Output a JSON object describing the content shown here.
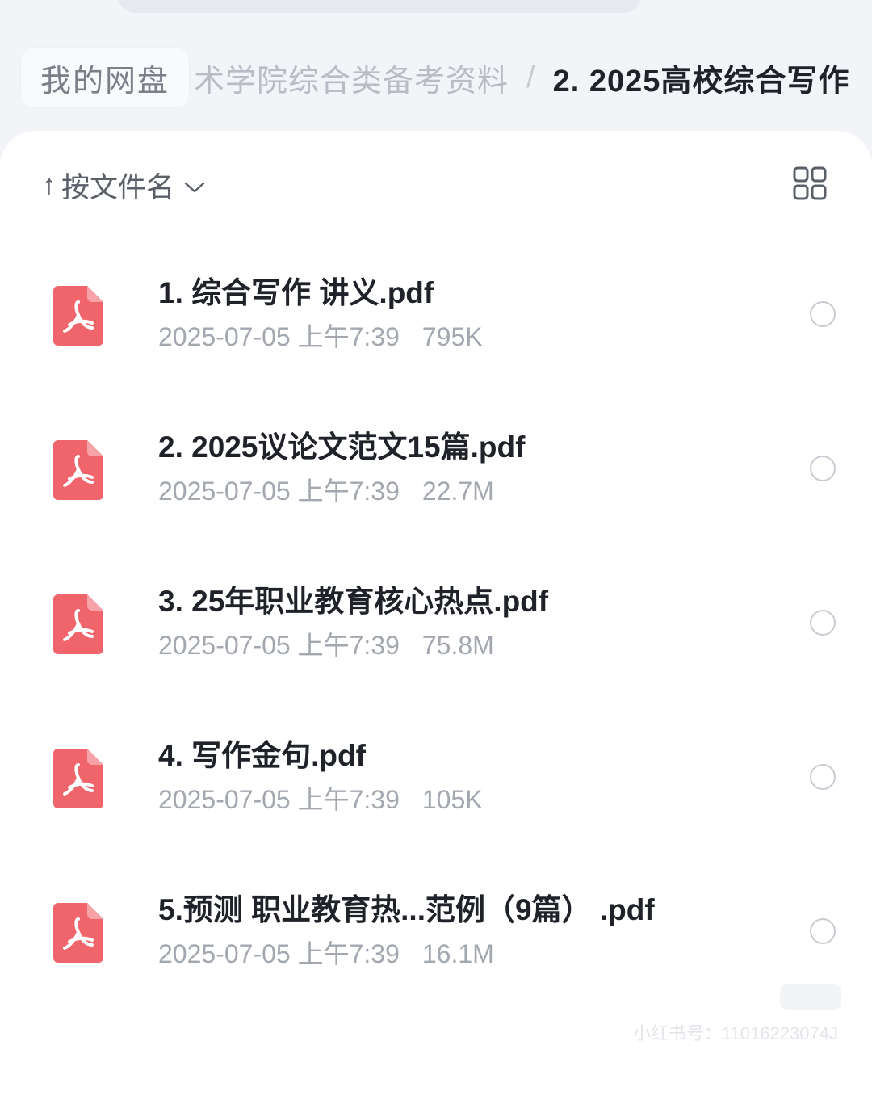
{
  "breadcrumb": {
    "root": "我的网盘",
    "middle": "术学院综合类备考资料",
    "separator": "/",
    "current": "2. 2025高校综合写作"
  },
  "toolbar": {
    "sort_label": "按文件名",
    "sort_arrow": "↑",
    "view_toggle_icon": "grid-icon"
  },
  "files": [
    {
      "name": "1. 综合写作 讲义.pdf",
      "date": "2025-07-05 上午7:39",
      "size": "795K",
      "icon": "pdf-icon"
    },
    {
      "name": "2. 2025议论文范文15篇.pdf",
      "date": "2025-07-05 上午7:39",
      "size": "22.7M",
      "icon": "pdf-icon"
    },
    {
      "name": "3. 25年职业教育核心热点.pdf",
      "date": "2025-07-05 上午7:39",
      "size": "75.8M",
      "icon": "pdf-icon"
    },
    {
      "name": "4. 写作金句.pdf",
      "date": "2025-07-05 上午7:39",
      "size": "105K",
      "icon": "pdf-icon"
    },
    {
      "name": "5.预测 职业教育热...范例（9篇） .pdf",
      "date": "2025-07-05 上午7:39",
      "size": "16.1M",
      "icon": "pdf-icon"
    }
  ],
  "watermark": "小红书号：11016223074J",
  "colors": {
    "pdf_icon": "#f0646b",
    "background": "#f2f4f8",
    "panel": "#ffffff",
    "meta_text": "#a3a8b0"
  }
}
